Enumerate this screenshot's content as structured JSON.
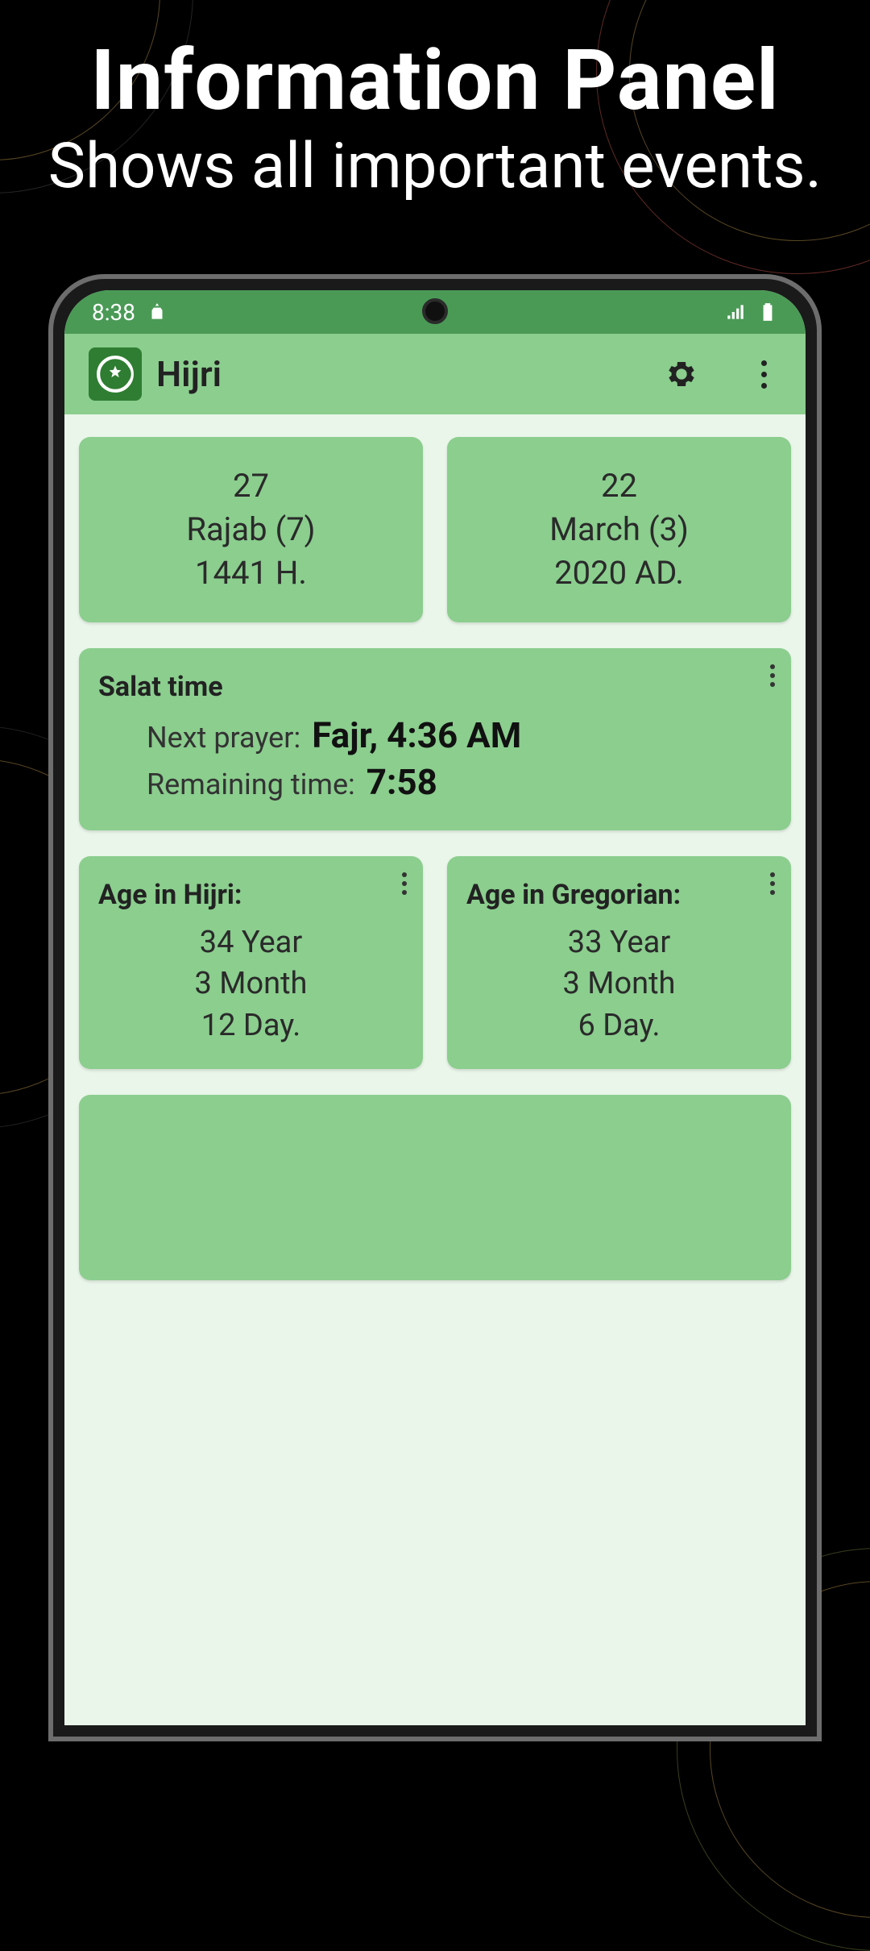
{
  "promo": {
    "title": "Information Panel",
    "subtitle": "Shows all important events."
  },
  "statusbar": {
    "time": "8:38"
  },
  "appbar": {
    "title": "Hijri"
  },
  "hijri_date": {
    "day": "27",
    "month": "Rajab (7)",
    "year": "1441 H."
  },
  "gregorian_date": {
    "day": "22",
    "month": "March (3)",
    "year": "2020 AD."
  },
  "salat": {
    "header": "Salat time",
    "next_prayer_label": "Next prayer:",
    "next_prayer_value": "Fajr, 4:36 AM",
    "remaining_label": "Remaining time:",
    "remaining_value": "7:58"
  },
  "age_hijri": {
    "header": "Age in Hijri:",
    "year": "34 Year",
    "month": "3 Month",
    "day": "12 Day."
  },
  "age_gregorian": {
    "header": "Age in Gregorian:",
    "year": "33 Year",
    "month": "3 Month",
    "day": "6 Day."
  }
}
